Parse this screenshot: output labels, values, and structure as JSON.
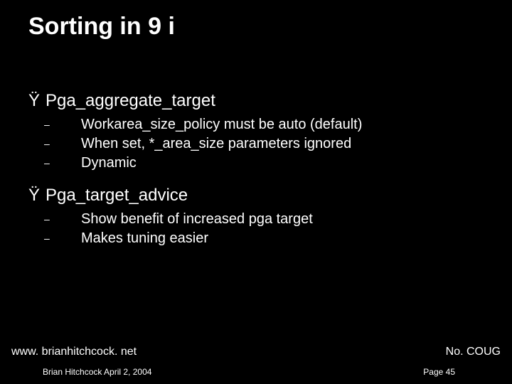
{
  "title": "Sorting in 9 i",
  "bullets": [
    {
      "marker": "Ÿ",
      "text": "Pga_aggregate_target",
      "sub": [
        {
          "marker": "–",
          "text": "Workarea_size_policy must be auto (default)"
        },
        {
          "marker": "–",
          "text": "When set, *_area_size parameters ignored"
        },
        {
          "marker": "–",
          "text": "Dynamic"
        }
      ]
    },
    {
      "marker": "Ÿ",
      "text": "Pga_target_advice",
      "sub": [
        {
          "marker": "–",
          "text": "Show benefit of increased pga target"
        },
        {
          "marker": "–",
          "text": "Makes tuning easier"
        }
      ]
    }
  ],
  "footer": {
    "url": "www. brianhitchcock. net",
    "org": "No. COUG",
    "author": "Brian Hitchcock  April 2, 2004",
    "page": "Page 45"
  }
}
